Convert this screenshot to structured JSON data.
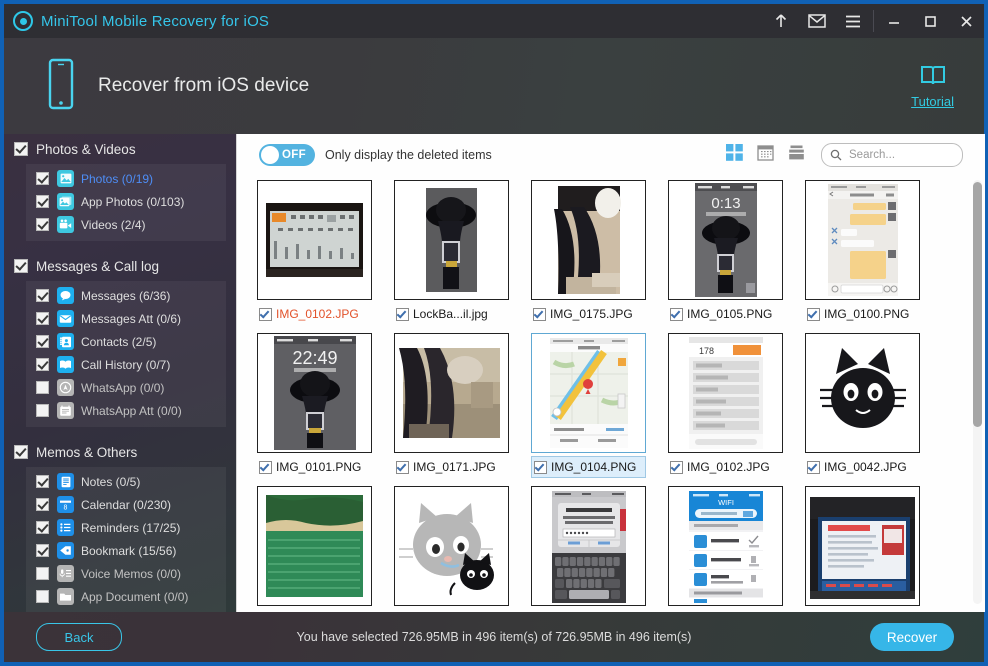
{
  "window": {
    "title": "MiniTool Mobile Recovery for iOS",
    "logo_icon": "target-logo-icon",
    "buttons": [
      {
        "name": "upgrade-icon",
        "glyph": "↑"
      },
      {
        "name": "mail-icon",
        "glyph": "✉"
      },
      {
        "name": "menu-icon",
        "glyph": "☰"
      },
      {
        "name": "minimize-icon",
        "glyph": "—"
      },
      {
        "name": "maximize-icon",
        "glyph": "▢"
      },
      {
        "name": "close-icon",
        "glyph": "✕"
      }
    ]
  },
  "header": {
    "device_icon": "iphone-icon",
    "title": "Recover from iOS device",
    "tutorial_icon": "book-icon",
    "tutorial_label": "Tutorial"
  },
  "sidebar": {
    "groups": [
      {
        "label": "Photos & Videos",
        "checked": true,
        "items": [
          {
            "label": "Photos (0/19)",
            "checked": true,
            "active": true,
            "icon": "photo-icon",
            "color": "#3ec8e0"
          },
          {
            "label": "App Photos (0/103)",
            "checked": true,
            "active": false,
            "icon": "app-photos-icon",
            "color": "#3ec8e0"
          },
          {
            "label": "Videos (2/4)",
            "checked": true,
            "active": false,
            "icon": "video-icon",
            "color": "#3ec8e0"
          }
        ]
      },
      {
        "label": "Messages & Call log",
        "checked": true,
        "items": [
          {
            "label": "Messages (6/36)",
            "checked": true,
            "active": false,
            "icon": "message-bubble-icon",
            "color": "#1eb0ef"
          },
          {
            "label": "Messages Att (0/6)",
            "checked": true,
            "active": false,
            "icon": "envelope-icon",
            "color": "#1eb0ef"
          },
          {
            "label": "Contacts (2/5)",
            "checked": true,
            "active": false,
            "icon": "contacts-book-icon",
            "color": "#1eb0ef"
          },
          {
            "label": "Call History (0/7)",
            "checked": true,
            "active": false,
            "icon": "call-history-icon",
            "color": "#1eb0ef"
          },
          {
            "label": "WhatsApp (0/0)",
            "checked": false,
            "active": false,
            "icon": "whatsapp-icon",
            "color": "#b5b5b5"
          },
          {
            "label": "WhatsApp Att (0/0)",
            "checked": false,
            "active": false,
            "icon": "whatsapp-attachment-icon",
            "color": "#b5b5b5"
          }
        ]
      },
      {
        "label": "Memos & Others",
        "checked": true,
        "items": [
          {
            "label": "Notes (0/5)",
            "checked": true,
            "active": false,
            "icon": "notes-icon",
            "color": "#1e8fe8"
          },
          {
            "label": "Calendar (0/230)",
            "checked": true,
            "active": false,
            "icon": "calendar-icon",
            "color": "#1e8fe8"
          },
          {
            "label": "Reminders (17/25)",
            "checked": true,
            "active": false,
            "icon": "reminders-icon",
            "color": "#1e8fe8"
          },
          {
            "label": "Bookmark (15/56)",
            "checked": true,
            "active": false,
            "icon": "bookmark-tag-icon",
            "color": "#1e8fe8"
          },
          {
            "label": "Voice Memos (0/0)",
            "checked": false,
            "active": false,
            "icon": "voice-memo-icon",
            "color": "#b5b5b5"
          },
          {
            "label": "App Document (0/0)",
            "checked": false,
            "active": false,
            "icon": "folder-icon",
            "color": "#b5b5b5"
          }
        ]
      }
    ]
  },
  "toolbar": {
    "toggle_state": "OFF",
    "toggle_label": "Only display the deleted items",
    "view_grid_icon": "grid-view-icon",
    "view_calendar_icon": "calendar-view-icon",
    "view_list_icon": "list-view-icon",
    "search_placeholder": "Search...",
    "search_value": "",
    "search_icon": "search-icon"
  },
  "grid": {
    "rows": [
      [
        {
          "name": "IMG_0102.JPG",
          "checked": true,
          "deleted": true,
          "selected": false,
          "art": "whiteboard"
        },
        {
          "name": "LockBa...il.jpg",
          "checked": true,
          "deleted": false,
          "selected": false,
          "art": "doll"
        },
        {
          "name": "IMG_0175.JPG",
          "checked": true,
          "deleted": false,
          "selected": false,
          "art": "legs"
        },
        {
          "name": "IMG_0105.PNG",
          "checked": true,
          "deleted": false,
          "selected": false,
          "art": "lockscreen"
        },
        {
          "name": "IMG_0100.PNG",
          "checked": true,
          "deleted": false,
          "selected": false,
          "art": "chat"
        }
      ],
      [
        {
          "name": "IMG_0101.PNG",
          "checked": true,
          "deleted": false,
          "selected": false,
          "art": "lockscreen2"
        },
        {
          "name": "IMG_0171.JPG",
          "checked": true,
          "deleted": false,
          "selected": false,
          "art": "room"
        },
        {
          "name": "IMG_0104.PNG",
          "checked": true,
          "deleted": false,
          "selected": true,
          "art": "map"
        },
        {
          "name": "IMG_0102.JPG",
          "checked": true,
          "deleted": false,
          "selected": false,
          "art": "appscreen"
        },
        {
          "name": "IMG_0042.JPG",
          "checked": true,
          "deleted": false,
          "selected": false,
          "art": "cat"
        }
      ],
      [
        {
          "name": "",
          "checked": false,
          "deleted": false,
          "selected": false,
          "art": "lake"
        },
        {
          "name": "",
          "checked": false,
          "deleted": false,
          "selected": false,
          "art": "graycat"
        },
        {
          "name": "",
          "checked": false,
          "deleted": false,
          "selected": false,
          "art": "keyboard"
        },
        {
          "name": "",
          "checked": false,
          "deleted": false,
          "selected": false,
          "art": "wifi"
        },
        {
          "name": "",
          "checked": false,
          "deleted": false,
          "selected": false,
          "art": "screenphoto"
        }
      ]
    ]
  },
  "footer": {
    "back_label": "Back",
    "status": "You have selected 726.95MB in 496 item(s) of 726.95MB in 496 item(s)",
    "recover_label": "Recover"
  },
  "colors": {
    "accent": "#36b6e8",
    "title_accent": "#35c6ea",
    "deleted_text": "#e2522a",
    "window_border": "#1061b5"
  }
}
